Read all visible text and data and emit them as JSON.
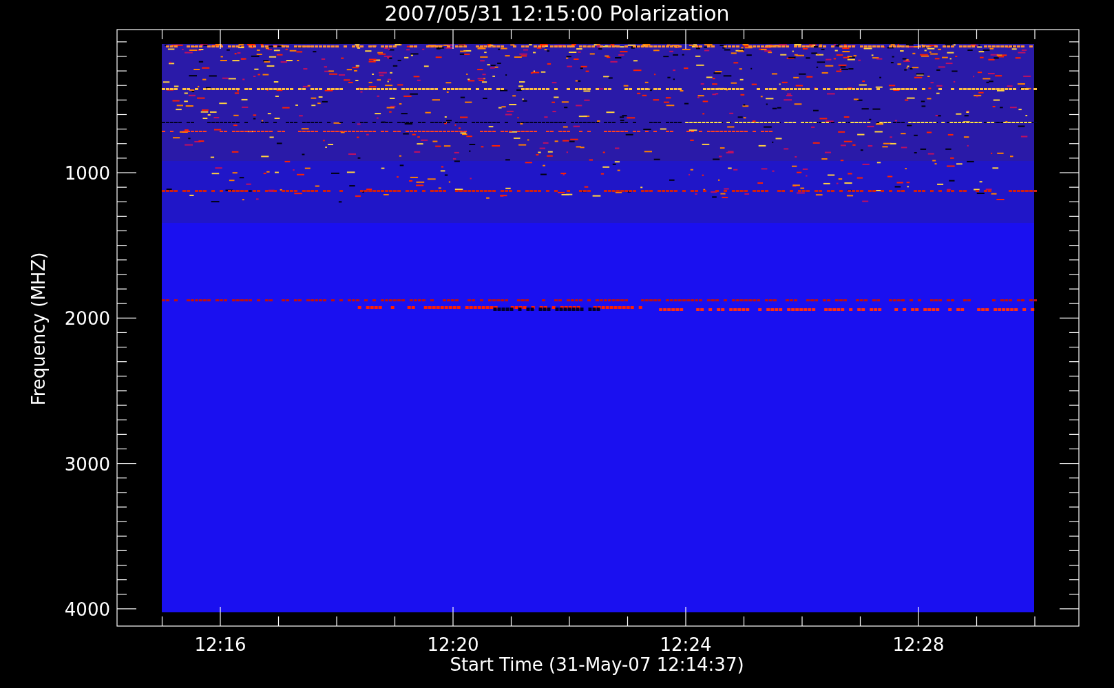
{
  "title": "2007/05/31 12:15:00 Polarization",
  "y_axis": {
    "label": "Frequency (MHZ)",
    "ticks": [
      "1000",
      "2000",
      "3000",
      "4000"
    ]
  },
  "x_axis": {
    "label": "Start Time (31-May-07 12:14:37)",
    "ticks": [
      "12:16",
      "12:20",
      "12:24",
      "12:28"
    ]
  }
}
